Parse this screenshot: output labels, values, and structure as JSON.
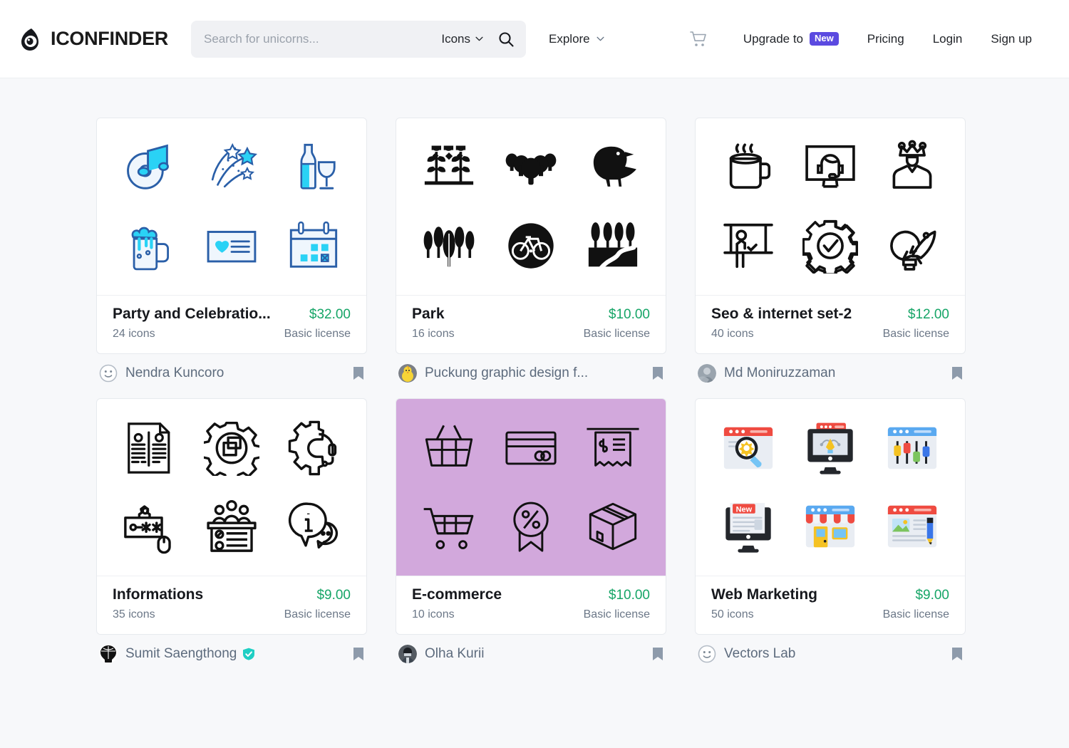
{
  "header": {
    "logo_text": "ICONFINDER",
    "logo_icon": "iconfinder-eye-logo",
    "search": {
      "placeholder": "Search for unicorns...",
      "value": "",
      "type_label": "Icons",
      "type_chevron_icon": "chevron-down-icon",
      "search_icon": "search-icon"
    },
    "explore": {
      "label": "Explore",
      "chevron_icon": "chevron-down-icon"
    },
    "cart_icon": "shopping-cart-icon",
    "links": [
      {
        "label": "Upgrade to",
        "badge": "New",
        "badge_color": "#5b4ae0"
      },
      {
        "label": "Pricing"
      },
      {
        "label": "Login"
      },
      {
        "label": "Sign up"
      }
    ]
  },
  "colors": {
    "price": "#16a567",
    "page_bg": "#f7f8fa",
    "tinted_card_bg": "#d2a8dc",
    "verified_badge": "#1fcfc4",
    "badge_new": "#5b4ae0"
  },
  "cards": [
    {
      "title": "Party and Celebratio...",
      "price": "$32.00",
      "count": "24 icons",
      "license": "Basic license",
      "author": "Nendra Kuncoro",
      "avatar_icon": "smiley-face-avatar",
      "verified": false,
      "tinted": false,
      "bookmark_icon": "bookmark-icon",
      "icons": [
        "music-disc-note-icon",
        "shooting-stars-icon",
        "wine-bottle-glass-icon",
        "beer-mug-icon",
        "invitation-card-heart-icon",
        "calendar-icon"
      ]
    },
    {
      "title": "Park",
      "price": "$10.00",
      "count": "16 icons",
      "license": "Basic license",
      "author": "Puckung graphic design f...",
      "avatar_icon": "chick-avatar",
      "verified": false,
      "tinted": false,
      "bookmark_icon": "bookmark-icon",
      "icons": [
        "tulip-flowers-icon",
        "bushes-icon",
        "bird-icon",
        "trees-icon",
        "bicycle-circle-icon",
        "park-path-icon"
      ]
    },
    {
      "title": "Seo & internet set-2",
      "price": "$12.00",
      "count": "40 icons",
      "license": "Basic license",
      "author": "Md Moniruzzaman",
      "avatar_icon": "photo-avatar",
      "verified": false,
      "tinted": false,
      "bookmark_icon": "bookmark-icon",
      "icons": [
        "coffee-mug-icon",
        "support-monitor-icon",
        "king-crown-person-icon",
        "presentation-icon",
        "gear-check-icon",
        "rocket-lightbulb-icon"
      ]
    },
    {
      "title": "Informations",
      "price": "$9.00",
      "count": "35 icons",
      "license": "Basic license",
      "author": "Sumit Saengthong",
      "avatar_icon": "balloon-avatar",
      "verified": true,
      "tinted": false,
      "bookmark_icon": "bookmark-icon",
      "icons": [
        "resume-document-icon",
        "gear-windows-icon",
        "headset-gear-icon",
        "password-mouse-icon",
        "meeting-panel-icon",
        "info-chat-icon"
      ]
    },
    {
      "title": "E-commerce",
      "price": "$10.00",
      "count": "10 icons",
      "license": "Basic license",
      "author": "Olha Kurii",
      "avatar_icon": "person-photo-avatar",
      "verified": false,
      "tinted": true,
      "bookmark_icon": "bookmark-icon",
      "icons": [
        "shopping-basket-icon",
        "credit-card-icon",
        "receipt-icon",
        "shopping-cart-icon",
        "discount-ribbon-icon",
        "package-box-icon"
      ]
    },
    {
      "title": "Web Marketing",
      "price": "$9.00",
      "count": "50 icons",
      "license": "Basic license",
      "author": "Vectors Lab",
      "avatar_icon": "smiley-face-avatar",
      "verified": false,
      "tinted": false,
      "bookmark_icon": "bookmark-icon",
      "icons": [
        "seo-search-gear-icon",
        "design-monitor-pen-icon",
        "settings-sliders-icon",
        "new-article-monitor-icon",
        "online-shop-icon",
        "content-edit-icon"
      ]
    }
  ]
}
